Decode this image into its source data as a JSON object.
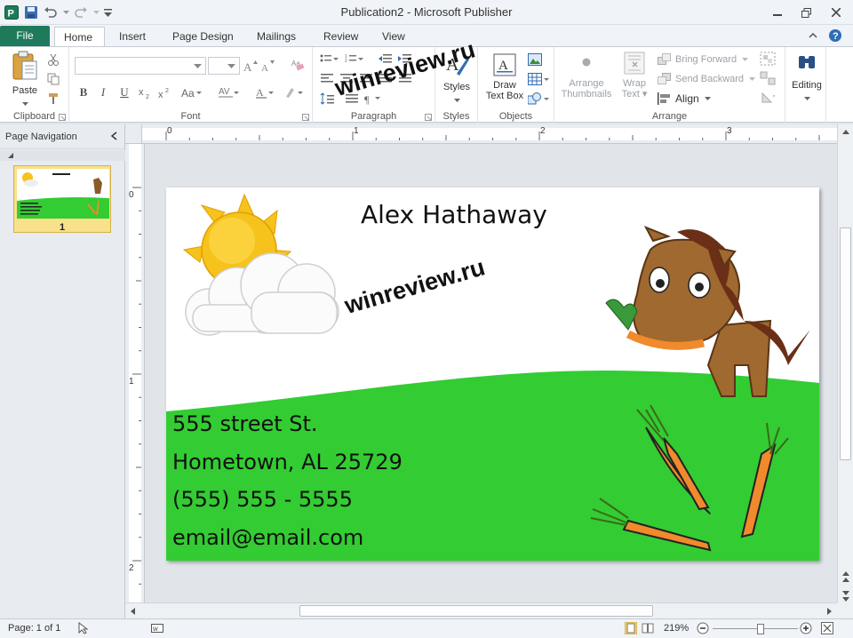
{
  "window": {
    "title": "Publication2  -  Microsoft Publisher"
  },
  "tabs": [
    {
      "label": "File"
    },
    {
      "label": "Home"
    },
    {
      "label": "Insert"
    },
    {
      "label": "Page Design"
    },
    {
      "label": "Mailings"
    },
    {
      "label": "Review"
    },
    {
      "label": "View"
    }
  ],
  "ribbon": {
    "clipboard": {
      "group": "Clipboard",
      "paste": "Paste"
    },
    "font": {
      "group": "Font"
    },
    "paragraph": {
      "group": "Paragraph"
    },
    "styles": {
      "group": "Styles",
      "button": "Styles"
    },
    "objects": {
      "group": "Objects",
      "draw_text_box_line1": "Draw",
      "draw_text_box_line2": "Text Box"
    },
    "arrange": {
      "group": "Arrange",
      "arrange_thumbnails_line1": "Arrange",
      "arrange_thumbnails_line2": "Thumbnails",
      "wrap_text_line1": "Wrap",
      "wrap_text_line2": "Text",
      "bring_forward": "Bring Forward",
      "send_backward": "Send Backward",
      "align": "Align"
    },
    "editing": {
      "button": "Editing"
    }
  },
  "nav_pane": {
    "title": "Page Navigation",
    "page_number": "1"
  },
  "ruler": {
    "h_marks": [
      "0",
      "1",
      "2",
      "3"
    ],
    "v_marks": [
      "0",
      "1",
      "2"
    ]
  },
  "card": {
    "name": "Alex Hathaway",
    "address": "555 street St.",
    "city": "Hometown, AL 25729",
    "phone": "(555) 555 - 5555",
    "email": "email@email.com"
  },
  "watermark": "winreview.ru",
  "status": {
    "page": "Page: 1 of 1",
    "zoom": "219%"
  },
  "colors": {
    "file_tab": "#1f7a5c",
    "grass": "#33cc33",
    "sun": "#f6c21c",
    "horse": "#8b5a2b",
    "carrot": "#f08a2c"
  }
}
